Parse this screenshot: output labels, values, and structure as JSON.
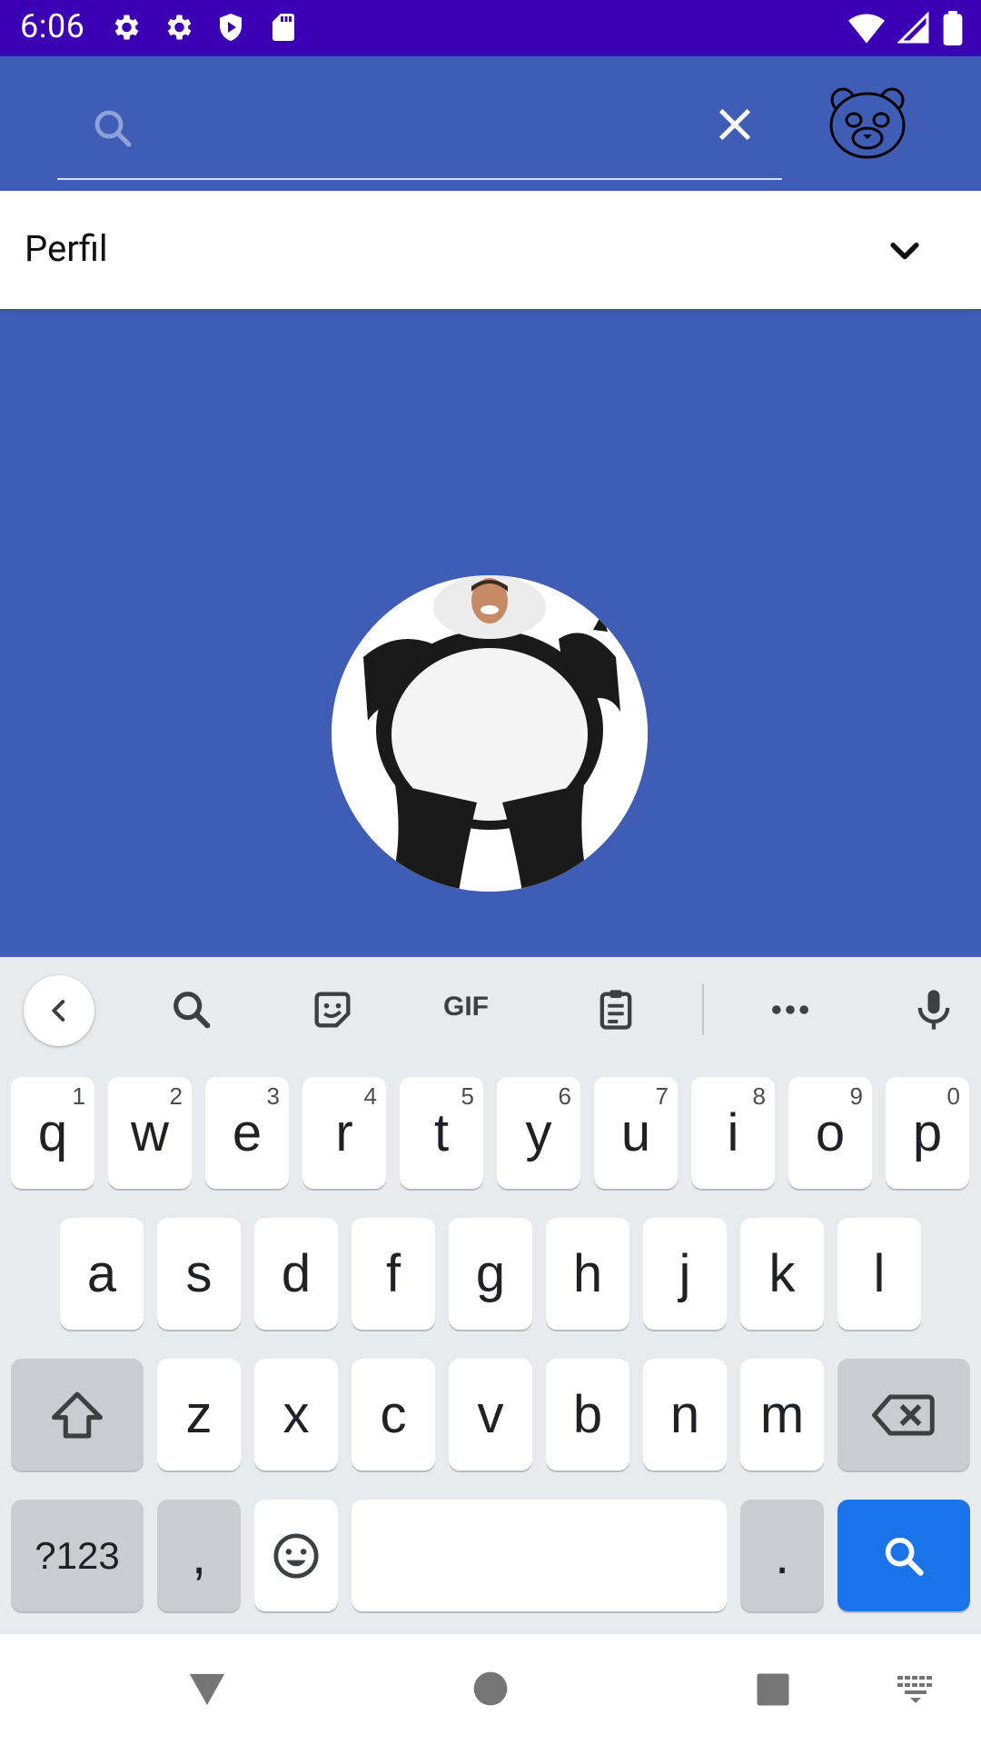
{
  "status_bar": {
    "time": "6:06",
    "left_icons": [
      "gear-icon",
      "gear-icon",
      "shield-play-icon",
      "sd-card-icon"
    ],
    "right_icons": [
      "wifi-icon",
      "signal-icon",
      "battery-icon"
    ]
  },
  "app_bar": {
    "search_placeholder": "",
    "search_value": "",
    "color": "#3f5db5"
  },
  "dropdown": {
    "selected": "Perfil"
  },
  "profile": {
    "avatar": "panda-costume-photo"
  },
  "keyboard": {
    "toolbar": [
      "back-icon",
      "search-icon",
      "sticker-icon",
      "GIF",
      "clipboard-icon",
      "more-icon",
      "mic-icon"
    ],
    "row1": [
      {
        "k": "q",
        "h": "1"
      },
      {
        "k": "w",
        "h": "2"
      },
      {
        "k": "e",
        "h": "3"
      },
      {
        "k": "r",
        "h": "4"
      },
      {
        "k": "t",
        "h": "5"
      },
      {
        "k": "y",
        "h": "6"
      },
      {
        "k": "u",
        "h": "7"
      },
      {
        "k": "i",
        "h": "8"
      },
      {
        "k": "o",
        "h": "9"
      },
      {
        "k": "p",
        "h": "0"
      }
    ],
    "row2": [
      "a",
      "s",
      "d",
      "f",
      "g",
      "h",
      "j",
      "k",
      "l"
    ],
    "row3": [
      "z",
      "x",
      "c",
      "v",
      "b",
      "n",
      "m"
    ],
    "symbols_label": "?123",
    "comma": ",",
    "period": ".",
    "accent": "#1a73e8"
  },
  "nav_bar": {
    "buttons": [
      "back-triangle-icon",
      "home-circle-icon",
      "recents-square-icon",
      "keyboard-switch-icon"
    ]
  }
}
